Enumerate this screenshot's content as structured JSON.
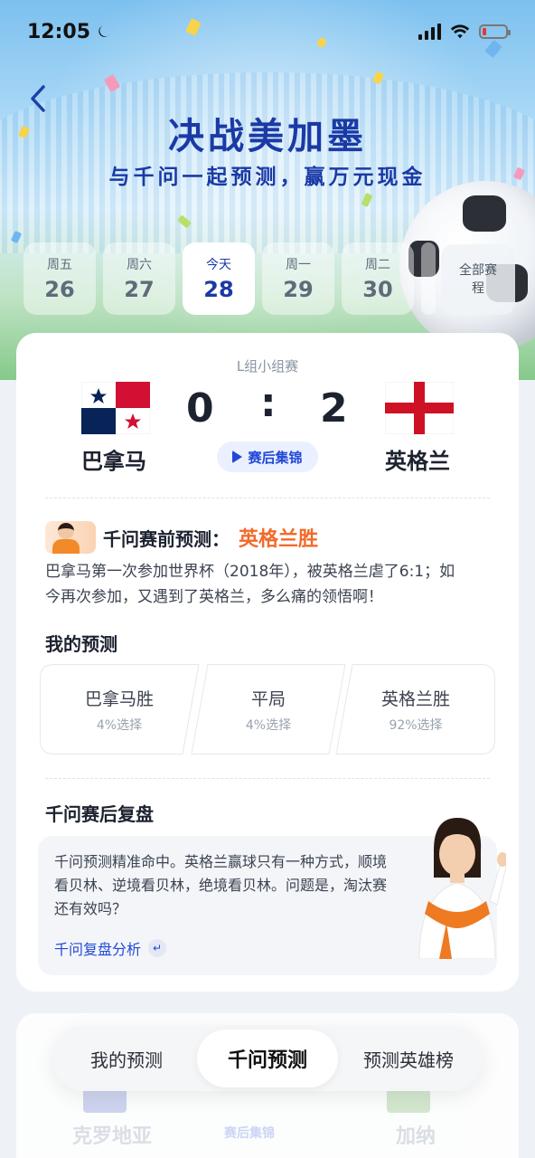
{
  "status_bar": {
    "time": "12:05",
    "icons": [
      "moon-icon",
      "signal-icon",
      "wifi-icon",
      "battery-low-icon"
    ]
  },
  "header": {
    "title": "决战美加墨",
    "subtitle": "与千问一起预测，赢万元现金"
  },
  "date_tabs": [
    {
      "weekday": "周五",
      "day": "26"
    },
    {
      "weekday": "周六",
      "day": "27"
    },
    {
      "weekday": "今天",
      "day": "28",
      "active": true
    },
    {
      "weekday": "周一",
      "day": "29"
    },
    {
      "weekday": "周二",
      "day": "30"
    }
  ],
  "all_schedule_label": "全部赛程",
  "match": {
    "group": "L组小组赛",
    "home_team": "巴拿马",
    "away_team": "英格兰",
    "home_score": "0",
    "away_score": "2",
    "separator": ":",
    "highlights_label": "赛后集锦"
  },
  "ai_prediction": {
    "label": "千问赛前预测：",
    "result": "英格兰胜",
    "description": "巴拿马第一次参加世界杯（2018年），被英格兰虐了6:1；如今再次参加，又遇到了英格兰，多么痛的领悟啊！"
  },
  "my_prediction": {
    "title": "我的预测",
    "options": [
      {
        "label": "巴拿马胜",
        "percent": "4%选择"
      },
      {
        "label": "平局",
        "percent": "4%选择"
      },
      {
        "label": "英格兰胜",
        "percent": "92%选择"
      }
    ]
  },
  "review": {
    "title": "千问赛后复盘",
    "text": "千问预测精准命中。英格兰赢球只有一种方式，顺境看贝林、逆境看贝林，绝境看贝林。问题是，淘汰赛还有效吗？",
    "link": "千问复盘分析"
  },
  "next_match_peek": {
    "home_team": "克罗地亚",
    "away_team": "加纳",
    "highlights_label": "赛后集锦"
  },
  "bottom_tabs": [
    {
      "label": "我的预测"
    },
    {
      "label": "千问预测",
      "active": true
    },
    {
      "label": "预测英雄榜"
    }
  ],
  "colors": {
    "brand_blue": "#1b3aa6",
    "link_blue": "#2148d6",
    "prediction_orange": "#f26a2a"
  }
}
